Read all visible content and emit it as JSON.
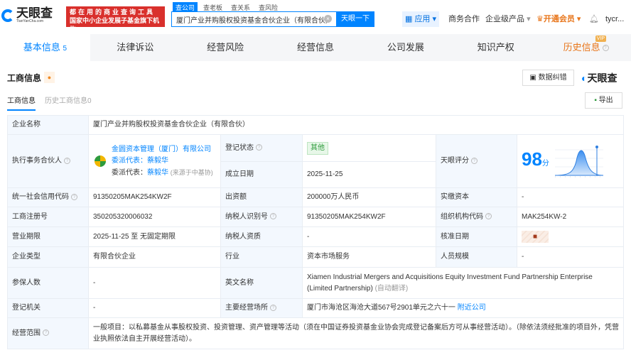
{
  "header": {
    "logo_text": "天眼查",
    "logo_sub": "TianYanCha.com",
    "banner_line1": "都在用的商业查询工具",
    "banner_line2": "国家中小企业发展子基金旗下机构",
    "search_tabs": [
      "查公司",
      "查老板",
      "查关系",
      "查风险"
    ],
    "search_value": "厦门产业并购股权投资基金合伙企业（有限合伙）",
    "search_button": "天眼一下",
    "app": "应用",
    "business": "商务合作",
    "enterprise": "企业级产品",
    "vip": "开通会员",
    "user": "tycr..."
  },
  "nav": {
    "tabs": [
      "基本信息",
      "法律诉讼",
      "经营风险",
      "经营信息",
      "公司发展",
      "知识产权",
      "历史信息"
    ],
    "basic_count": "5",
    "vip_badge": "VIP"
  },
  "section": {
    "title": "工商信息",
    "report_error": "数据纠错",
    "brand": "天眼查",
    "subtabs": [
      "工商信息",
      "历史工商信息0"
    ],
    "export": "导出"
  },
  "table": {
    "company_name_label": "企业名称",
    "company_name": "厦门产业并购股权投资基金合伙企业（有限合伙）",
    "partner_label": "执行事务合伙人",
    "partner_name": "金圆资本管理（厦门）有限公司",
    "rep1_label": "委派代表：",
    "rep1": "蔡毅华",
    "rep2_label": "委派代表：",
    "rep2": "蔡毅华",
    "rep2_note": "(来源于中基协)",
    "status_label": "登记状态",
    "status": "其他",
    "founded_label": "成立日期",
    "founded": "2025-11-25",
    "score_label": "天眼评分",
    "score": "98",
    "score_unit": "分",
    "rows": [
      [
        "统一社会信用代码",
        "91350205MAK254KW2F",
        "出资额",
        "200000万人民币",
        "实缴资本",
        "-"
      ],
      [
        "工商注册号",
        "350205320006032",
        "纳税人识别号",
        "91350205MAK254KW2F",
        "组织机构代码",
        "MAK254KW-2"
      ],
      [
        "营业期限",
        "2025-11-25 至 无固定期限",
        "纳税人资质",
        "-",
        "核准日期",
        ""
      ],
      [
        "企业类型",
        "有限合伙企业",
        "行业",
        "资本市场服务",
        "人员规模",
        "-"
      ]
    ],
    "insured_label": "参保人数",
    "insured": "-",
    "en_name_label": "英文名称",
    "en_name": "Xiamen Industrial Mergers and Acquisitions Equity Investment Fund Partnership Enterprise (Limited Partnership)",
    "auto_translate": "(自动翻译)",
    "authority_label": "登记机关",
    "authority": "-",
    "address_label": "主要经营场所",
    "address": "厦门市海沧区海沧大道567号2901单元之六十一",
    "nearby": "附近公司",
    "scope_label": "经营范围",
    "scope": "一般项目：以私募基金从事股权投资、投资管理、资产管理等活动（须在中国证券投资基金业协会完成登记备案后方可从事经营活动）。（除依法须经批准的项目外，凭营业执照依法自主开展经营活动）。"
  }
}
